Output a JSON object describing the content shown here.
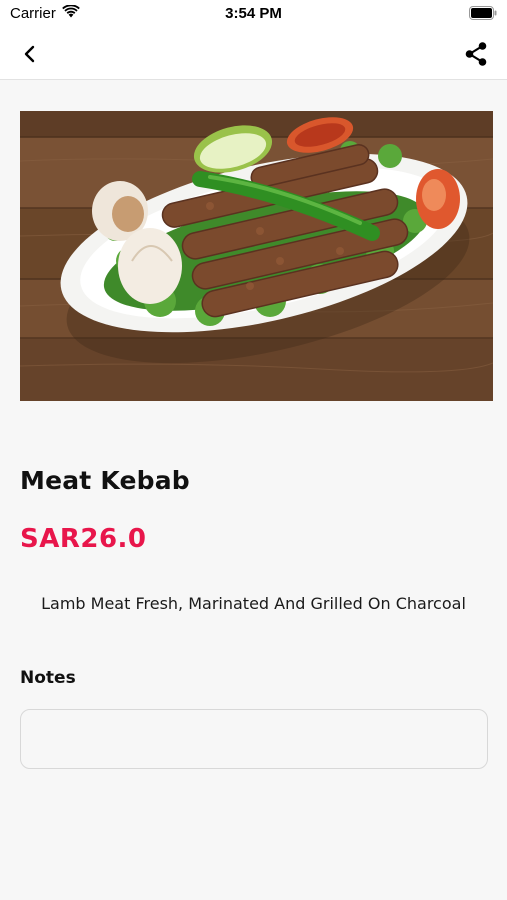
{
  "status_bar": {
    "carrier": "Carrier",
    "time": "3:54 PM"
  },
  "nav": {
    "back_icon": "chevron-left-icon",
    "share_icon": "share-icon"
  },
  "product": {
    "name": "Meat Kebab",
    "price": "SAR26.0",
    "description": "Lamb Meat Fresh, Marinated And Grilled On Charcoal",
    "price_color": "#e8164b"
  },
  "notes": {
    "label": "Notes",
    "value": "",
    "placeholder": ""
  }
}
